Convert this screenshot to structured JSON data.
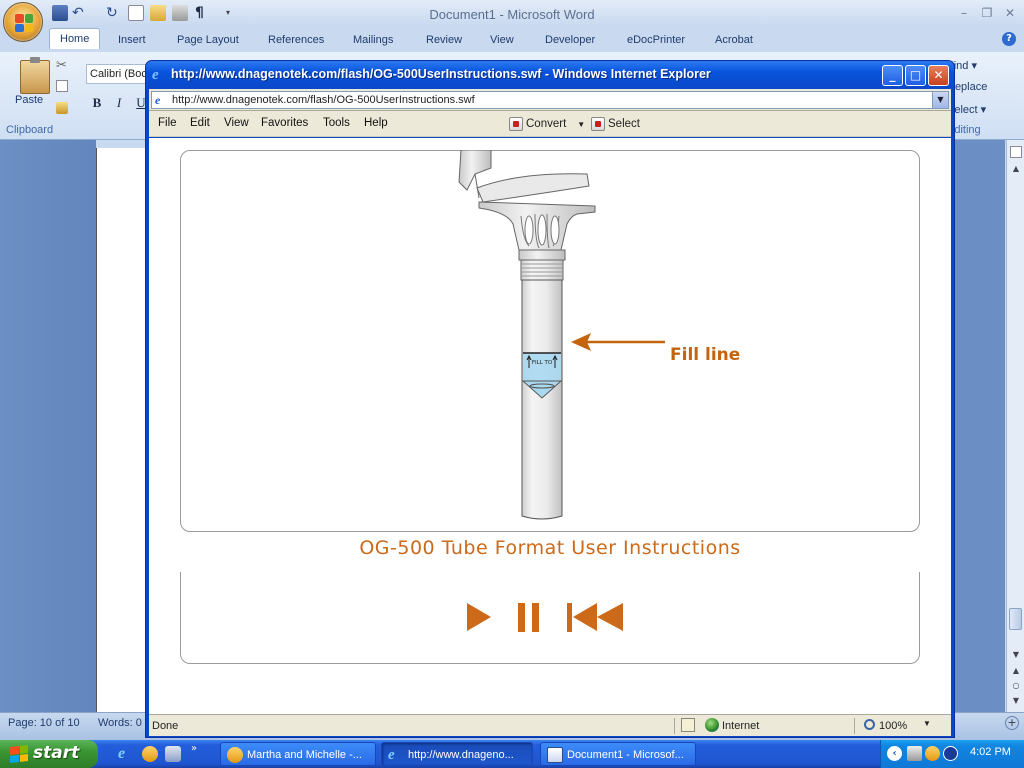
{
  "word": {
    "title": "Document1 - Microsoft Word",
    "tabs": [
      "Home",
      "Insert",
      "Page Layout",
      "References",
      "Mailings",
      "Review",
      "View",
      "Developer",
      "eDocPrinter",
      "Acrobat"
    ],
    "active_tab": "Home",
    "paste_label": "Paste",
    "clipboard_label": "Clipboard",
    "font_name": "Calibri (Boc",
    "format_buttons": [
      "B",
      "I",
      "U"
    ],
    "editing": {
      "find": "Find",
      "replace": "Replace",
      "select": "Select",
      "group_label": "Editing"
    },
    "status": {
      "page": "Page: 10 of 10",
      "words": "Words: 0"
    }
  },
  "ie": {
    "title": "http://www.dnagenotek.com/flash/OG-500UserInstructions.swf - Windows Internet Explorer",
    "address": "http://www.dnagenotek.com/flash/OG-500UserInstructions.swf",
    "menu": [
      "File",
      "Edit",
      "View",
      "Favorites",
      "Tools",
      "Help"
    ],
    "convert_label": "Convert",
    "select_label": "Select",
    "content": {
      "fill_label": "Fill line",
      "tube_text": "FILL TO",
      "title": "OG-500 Tube Format User Instructions",
      "controls": [
        "play-icon",
        "pause-icon",
        "rewind-icon"
      ],
      "accent": "#cc6a19"
    },
    "status": {
      "text": "Done",
      "zone": "Internet",
      "zoom": "100%"
    }
  },
  "taskbar": {
    "start_label": "start",
    "tasks": [
      {
        "label": "Martha and Michelle -...",
        "icon": "outlook-icon",
        "active": false
      },
      {
        "label": "http://www.dnageno...",
        "icon": "ie-icon",
        "active": true
      },
      {
        "label": "Document1 - Microsof...",
        "icon": "word-icon",
        "active": false
      }
    ],
    "clock": "4:02 PM"
  }
}
